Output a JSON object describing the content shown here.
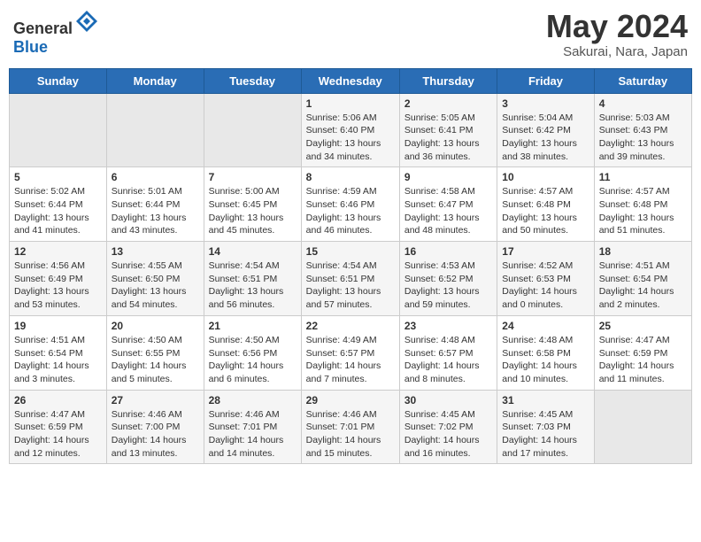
{
  "header": {
    "logo_general": "General",
    "logo_blue": "Blue",
    "month_year": "May 2024",
    "location": "Sakurai, Nara, Japan"
  },
  "weekdays": [
    "Sunday",
    "Monday",
    "Tuesday",
    "Wednesday",
    "Thursday",
    "Friday",
    "Saturday"
  ],
  "weeks": [
    [
      {
        "day": "",
        "info": ""
      },
      {
        "day": "",
        "info": ""
      },
      {
        "day": "",
        "info": ""
      },
      {
        "day": "1",
        "info": "Sunrise: 5:06 AM\nSunset: 6:40 PM\nDaylight: 13 hours\nand 34 minutes."
      },
      {
        "day": "2",
        "info": "Sunrise: 5:05 AM\nSunset: 6:41 PM\nDaylight: 13 hours\nand 36 minutes."
      },
      {
        "day": "3",
        "info": "Sunrise: 5:04 AM\nSunset: 6:42 PM\nDaylight: 13 hours\nand 38 minutes."
      },
      {
        "day": "4",
        "info": "Sunrise: 5:03 AM\nSunset: 6:43 PM\nDaylight: 13 hours\nand 39 minutes."
      }
    ],
    [
      {
        "day": "5",
        "info": "Sunrise: 5:02 AM\nSunset: 6:44 PM\nDaylight: 13 hours\nand 41 minutes."
      },
      {
        "day": "6",
        "info": "Sunrise: 5:01 AM\nSunset: 6:44 PM\nDaylight: 13 hours\nand 43 minutes."
      },
      {
        "day": "7",
        "info": "Sunrise: 5:00 AM\nSunset: 6:45 PM\nDaylight: 13 hours\nand 45 minutes."
      },
      {
        "day": "8",
        "info": "Sunrise: 4:59 AM\nSunset: 6:46 PM\nDaylight: 13 hours\nand 46 minutes."
      },
      {
        "day": "9",
        "info": "Sunrise: 4:58 AM\nSunset: 6:47 PM\nDaylight: 13 hours\nand 48 minutes."
      },
      {
        "day": "10",
        "info": "Sunrise: 4:57 AM\nSunset: 6:48 PM\nDaylight: 13 hours\nand 50 minutes."
      },
      {
        "day": "11",
        "info": "Sunrise: 4:57 AM\nSunset: 6:48 PM\nDaylight: 13 hours\nand 51 minutes."
      }
    ],
    [
      {
        "day": "12",
        "info": "Sunrise: 4:56 AM\nSunset: 6:49 PM\nDaylight: 13 hours\nand 53 minutes."
      },
      {
        "day": "13",
        "info": "Sunrise: 4:55 AM\nSunset: 6:50 PM\nDaylight: 13 hours\nand 54 minutes."
      },
      {
        "day": "14",
        "info": "Sunrise: 4:54 AM\nSunset: 6:51 PM\nDaylight: 13 hours\nand 56 minutes."
      },
      {
        "day": "15",
        "info": "Sunrise: 4:54 AM\nSunset: 6:51 PM\nDaylight: 13 hours\nand 57 minutes."
      },
      {
        "day": "16",
        "info": "Sunrise: 4:53 AM\nSunset: 6:52 PM\nDaylight: 13 hours\nand 59 minutes."
      },
      {
        "day": "17",
        "info": "Sunrise: 4:52 AM\nSunset: 6:53 PM\nDaylight: 14 hours\nand 0 minutes."
      },
      {
        "day": "18",
        "info": "Sunrise: 4:51 AM\nSunset: 6:54 PM\nDaylight: 14 hours\nand 2 minutes."
      }
    ],
    [
      {
        "day": "19",
        "info": "Sunrise: 4:51 AM\nSunset: 6:54 PM\nDaylight: 14 hours\nand 3 minutes."
      },
      {
        "day": "20",
        "info": "Sunrise: 4:50 AM\nSunset: 6:55 PM\nDaylight: 14 hours\nand 5 minutes."
      },
      {
        "day": "21",
        "info": "Sunrise: 4:50 AM\nSunset: 6:56 PM\nDaylight: 14 hours\nand 6 minutes."
      },
      {
        "day": "22",
        "info": "Sunrise: 4:49 AM\nSunset: 6:57 PM\nDaylight: 14 hours\nand 7 minutes."
      },
      {
        "day": "23",
        "info": "Sunrise: 4:48 AM\nSunset: 6:57 PM\nDaylight: 14 hours\nand 8 minutes."
      },
      {
        "day": "24",
        "info": "Sunrise: 4:48 AM\nSunset: 6:58 PM\nDaylight: 14 hours\nand 10 minutes."
      },
      {
        "day": "25",
        "info": "Sunrise: 4:47 AM\nSunset: 6:59 PM\nDaylight: 14 hours\nand 11 minutes."
      }
    ],
    [
      {
        "day": "26",
        "info": "Sunrise: 4:47 AM\nSunset: 6:59 PM\nDaylight: 14 hours\nand 12 minutes."
      },
      {
        "day": "27",
        "info": "Sunrise: 4:46 AM\nSunset: 7:00 PM\nDaylight: 14 hours\nand 13 minutes."
      },
      {
        "day": "28",
        "info": "Sunrise: 4:46 AM\nSunset: 7:01 PM\nDaylight: 14 hours\nand 14 minutes."
      },
      {
        "day": "29",
        "info": "Sunrise: 4:46 AM\nSunset: 7:01 PM\nDaylight: 14 hours\nand 15 minutes."
      },
      {
        "day": "30",
        "info": "Sunrise: 4:45 AM\nSunset: 7:02 PM\nDaylight: 14 hours\nand 16 minutes."
      },
      {
        "day": "31",
        "info": "Sunrise: 4:45 AM\nSunset: 7:03 PM\nDaylight: 14 hours\nand 17 minutes."
      },
      {
        "day": "",
        "info": ""
      }
    ]
  ]
}
